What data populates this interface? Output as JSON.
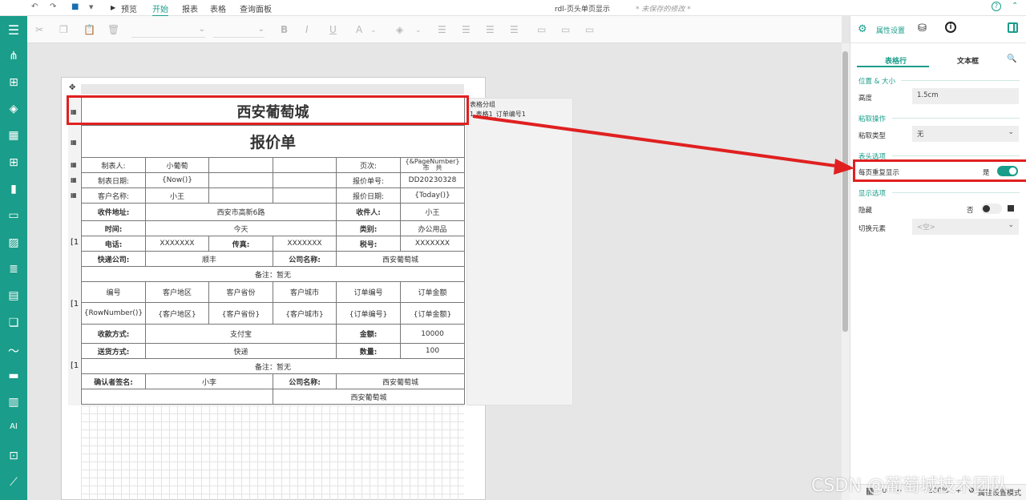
{
  "topbar": {
    "preview_label": "预览",
    "tabs": [
      "开始",
      "报表",
      "表格",
      "查询面板"
    ],
    "doc_title": "rdl-页头单页显示",
    "doc_status": "* 未保存的修改 *",
    "help_icon": "help-circle-icon"
  },
  "report": {
    "title": "西安葡萄城",
    "subtitle": "报价单",
    "r1": [
      "制表人:",
      "小葡萄",
      "",
      "",
      "页次:",
      "{&PageNumber}市　共"
    ],
    "r2": [
      "制表日期:",
      "{Now()}",
      "",
      "",
      "报价单号:",
      "DD20230328"
    ],
    "r3": [
      "客户名称:",
      "小王",
      "",
      "",
      "报价日期:",
      "{Today()}"
    ],
    "address": {
      "label": "收件地址:",
      "value": "西安市高新6路",
      "receiver_label": "收件人:",
      "receiver": "小王"
    },
    "time": {
      "label": "时间:",
      "value": "今天",
      "category_label": "类别:",
      "category": "办公用品"
    },
    "contact": {
      "phone_label": "电话:",
      "phone": "XXXXXXX",
      "fax_label": "传真:",
      "fax": "XXXXXXX",
      "tax_label": "税号:",
      "tax": "XXXXXXX"
    },
    "courier": {
      "label": "快递公司:",
      "value": "顺丰",
      "company_label": "公司名称:",
      "company": "西安葡萄城"
    },
    "note1": "备注：暂无",
    "detail_headers": [
      "编号",
      "客户地区",
      "客户省份",
      "客户城市",
      "订单编号",
      "订单金额"
    ],
    "detail_values": [
      "{RowNumber()}",
      "{客户地区}",
      "{客户省份}",
      "{客户城市}",
      "{订单编号}",
      "{订单金额}"
    ],
    "payment": {
      "label": "收款方式:",
      "value": "支付宝",
      "amount_label": "金额:",
      "amount": "10000"
    },
    "delivery": {
      "label": "送货方式:",
      "value": "快递",
      "qty_label": "数量:",
      "qty": "100"
    },
    "note2": "备注：暂无",
    "confirm": {
      "label": "确认者签名:",
      "value": "小李",
      "company_label": "公司名称:",
      "company": "西安葡萄城"
    },
    "footer_company": "西安葡萄城",
    "group_markers": [
      "[1",
      "[1",
      "[1"
    ]
  },
  "group_panel": {
    "title": "表格分组",
    "item": "1 表格1_订单编号1"
  },
  "right_panel": {
    "tab_settings": "属性设置",
    "subtabs": [
      "表格行",
      "文本框"
    ],
    "sections": {
      "position": "位置 & 大小",
      "paste": "粘取操作",
      "header": "表头选项",
      "display": "显示选项"
    },
    "height_label": "高度",
    "height_value": "1.5cm",
    "paste_type_label": "粘取类型",
    "paste_type_value": "无",
    "repeat_label": "每页重复显示",
    "repeat_value": "是",
    "hide_label": "隐藏",
    "hide_value": "否",
    "toggle_label": "切换元素",
    "toggle_placeholder": "<空>"
  },
  "zoombar": {
    "zoom": "100%",
    "mode": "属性设置模式"
  },
  "watermark": "CSDN @葡萄城技术团队",
  "colors": {
    "accent": "#1a9d8a",
    "highlight": "#e02020"
  }
}
